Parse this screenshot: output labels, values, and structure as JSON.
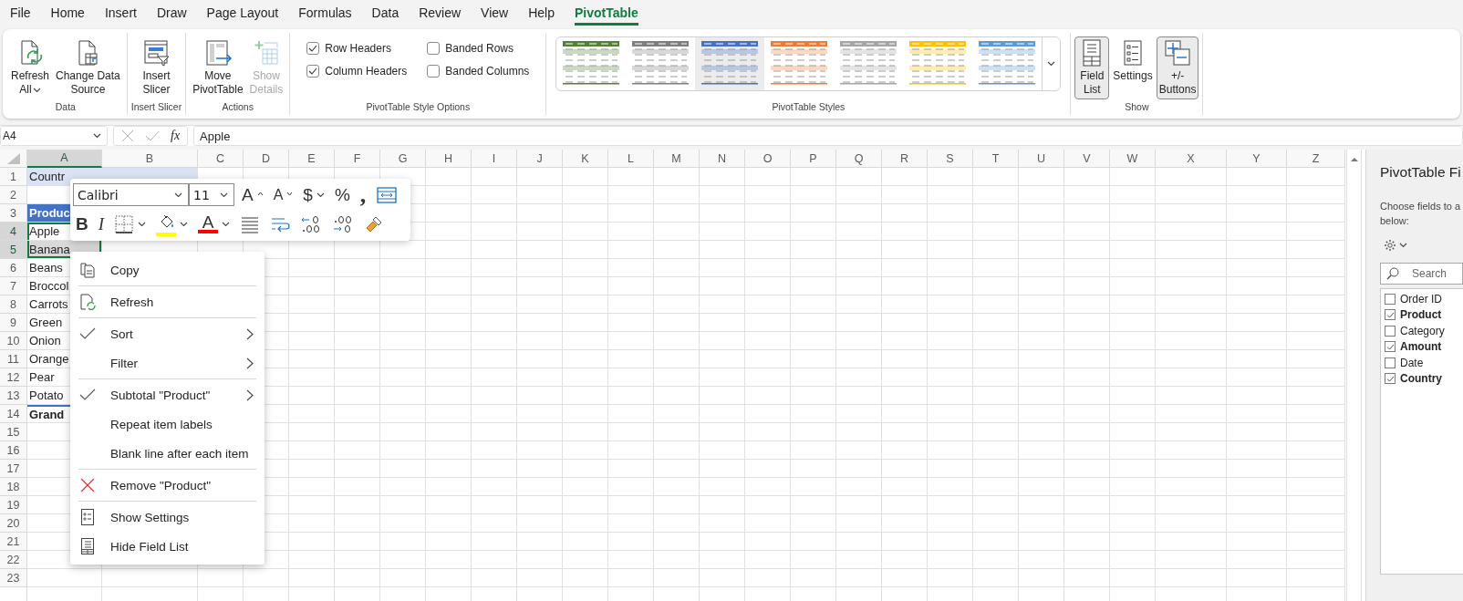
{
  "menu_tabs": [
    {
      "label": "File",
      "selected": false
    },
    {
      "label": "Home",
      "selected": false
    },
    {
      "label": "Insert",
      "selected": false
    },
    {
      "label": "Draw",
      "selected": false
    },
    {
      "label": "Page Layout",
      "selected": false
    },
    {
      "label": "Formulas",
      "selected": false
    },
    {
      "label": "Data",
      "selected": false
    },
    {
      "label": "Review",
      "selected": false
    },
    {
      "label": "View",
      "selected": false
    },
    {
      "label": "Help",
      "selected": false
    },
    {
      "label": "PivotTable",
      "selected": true
    }
  ],
  "ribbon": {
    "groups": [
      {
        "label": "Data",
        "items": [
          {
            "kind": "button",
            "lines": [
              "Refresh",
              "All"
            ],
            "caret": true,
            "disabled": false,
            "pressed": false
          },
          {
            "kind": "button",
            "lines": [
              "Change Data",
              "Source"
            ],
            "caret": false,
            "disabled": false,
            "pressed": false
          }
        ]
      },
      {
        "label": "Insert Slicer",
        "items": [
          {
            "kind": "button",
            "lines": [
              "Insert",
              "Slicer"
            ],
            "caret": false,
            "disabled": false,
            "pressed": false
          }
        ]
      },
      {
        "label": "Actions",
        "items": [
          {
            "kind": "button",
            "lines": [
              "Move",
              "PivotTable"
            ],
            "caret": false,
            "disabled": false,
            "pressed": false
          },
          {
            "kind": "button",
            "lines": [
              "Show",
              "Details"
            ],
            "caret": false,
            "disabled": true,
            "pressed": false
          }
        ]
      },
      {
        "label": "PivotTable Style Options",
        "items": [
          {
            "kind": "checkbox",
            "label": "Row Headers",
            "checked": true
          },
          {
            "kind": "checkbox",
            "label": "Column Headers",
            "checked": true
          },
          {
            "kind": "checkbox",
            "label": "Banded Rows",
            "checked": false
          },
          {
            "kind": "checkbox",
            "label": "Banded Columns",
            "checked": false
          }
        ]
      },
      {
        "label": "PivotTable Styles",
        "items": [
          {
            "kind": "gallery",
            "styles": [
              {
                "color": "#548235",
                "selected": false
              },
              {
                "color": "#7f7f7f",
                "selected": false
              },
              {
                "color": "#4472c4",
                "selected": true
              },
              {
                "color": "#ed7d31",
                "selected": false
              },
              {
                "color": "#a5a5a5",
                "selected": false
              },
              {
                "color": "#ffc000",
                "selected": false
              },
              {
                "color": "#5b9bd5",
                "selected": false
              }
            ]
          }
        ]
      },
      {
        "label": "Show",
        "items": [
          {
            "kind": "button",
            "lines": [
              "Field",
              "List"
            ],
            "caret": false,
            "disabled": false,
            "pressed": true
          },
          {
            "kind": "button",
            "lines": [
              "Settings"
            ],
            "caret": false,
            "disabled": false,
            "pressed": false
          },
          {
            "kind": "button",
            "lines": [
              "+/-",
              "Buttons"
            ],
            "caret": false,
            "disabled": false,
            "pressed": true
          }
        ]
      }
    ]
  },
  "formula_bar": {
    "name_box": "A4",
    "function_label": "fx",
    "formula": "Apple"
  },
  "sheet": {
    "columns": [
      {
        "label": "A",
        "selected": true
      },
      {
        "label": "B",
        "selected": false
      },
      {
        "label": "C",
        "selected": false
      },
      {
        "label": "D",
        "selected": false
      },
      {
        "label": "E",
        "selected": false
      },
      {
        "label": "F",
        "selected": false
      },
      {
        "label": "G",
        "selected": false
      },
      {
        "label": "H",
        "selected": false
      },
      {
        "label": "I",
        "selected": false
      },
      {
        "label": "J",
        "selected": false
      },
      {
        "label": "K",
        "selected": false
      },
      {
        "label": "L",
        "selected": false
      },
      {
        "label": "M",
        "selected": false
      },
      {
        "label": "N",
        "selected": false
      },
      {
        "label": "O",
        "selected": false
      },
      {
        "label": "P",
        "selected": false
      },
      {
        "label": "Q",
        "selected": false
      },
      {
        "label": "R",
        "selected": false
      },
      {
        "label": "S",
        "selected": false
      },
      {
        "label": "T",
        "selected": false
      },
      {
        "label": "U",
        "selected": false
      },
      {
        "label": "V",
        "selected": false
      },
      {
        "label": "W",
        "selected": false
      },
      {
        "label": "X",
        "selected": false
      },
      {
        "label": "Y",
        "selected": false
      },
      {
        "label": "Z",
        "selected": false
      }
    ],
    "rows": [
      {
        "label": "1",
        "selected": false,
        "cell_a": {
          "text": "Countr",
          "kind": "filter",
          "selected": false
        }
      },
      {
        "label": "2",
        "selected": false
      },
      {
        "label": "3",
        "selected": false,
        "cell_a": {
          "text": "Produc",
          "kind": "header",
          "selected": false
        }
      },
      {
        "label": "4",
        "selected": true,
        "cell_a": {
          "text": "Apple",
          "kind": "item",
          "selected": true
        }
      },
      {
        "label": "5",
        "selected": true,
        "cell_a": {
          "text": "Banana",
          "kind": "item",
          "selected": true
        }
      },
      {
        "label": "6",
        "selected": false,
        "cell_a": {
          "text": "Beans",
          "kind": "item",
          "selected": false
        }
      },
      {
        "label": "7",
        "selected": false,
        "cell_a": {
          "text": "Broccol",
          "kind": "item",
          "selected": false
        }
      },
      {
        "label": "8",
        "selected": false,
        "cell_a": {
          "text": "Carrots",
          "kind": "item",
          "selected": false
        }
      },
      {
        "label": "9",
        "selected": false,
        "cell_a": {
          "text": "Green",
          "kind": "item",
          "selected": false
        }
      },
      {
        "label": "10",
        "selected": false,
        "cell_a": {
          "text": "Onion",
          "kind": "item",
          "selected": false
        }
      },
      {
        "label": "11",
        "selected": false,
        "cell_a": {
          "text": "Orange",
          "kind": "item",
          "selected": false
        }
      },
      {
        "label": "12",
        "selected": false,
        "cell_a": {
          "text": "Pear",
          "kind": "item",
          "selected": false
        }
      },
      {
        "label": "13",
        "selected": false,
        "cell_a": {
          "text": "Potato",
          "kind": "item",
          "selected": false
        }
      },
      {
        "label": "14",
        "selected": false,
        "cell_a": {
          "text": "Grand",
          "kind": "total",
          "selected": false
        }
      },
      {
        "label": "15",
        "selected": false
      },
      {
        "label": "16",
        "selected": false
      },
      {
        "label": "17",
        "selected": false
      },
      {
        "label": "18",
        "selected": false
      },
      {
        "label": "19",
        "selected": false
      },
      {
        "label": "20",
        "selected": false
      },
      {
        "label": "21",
        "selected": false
      },
      {
        "label": "22",
        "selected": false
      },
      {
        "label": "23",
        "selected": false
      }
    ]
  },
  "mini_toolbar": {
    "font": "Calibri",
    "size": "11",
    "tools": [
      {
        "kind": "grow_font",
        "glyph": "A"
      },
      {
        "kind": "shrink_font",
        "glyph": "A"
      },
      {
        "kind": "currency",
        "glyph": "$"
      },
      {
        "kind": "percent",
        "glyph": "%"
      },
      {
        "kind": "comma",
        "glyph": ","
      },
      {
        "kind": "merge"
      }
    ],
    "tools_row2": [
      {
        "kind": "bold",
        "glyph": "B"
      },
      {
        "kind": "italic",
        "glyph": "I"
      },
      {
        "kind": "borders"
      },
      {
        "kind": "fill_color",
        "color": "#ffff00"
      },
      {
        "kind": "font_color",
        "glyph": "A",
        "color": "#ff0000"
      },
      {
        "kind": "align"
      },
      {
        "kind": "wrap_text"
      },
      {
        "kind": "increase_decimal"
      },
      {
        "kind": "decrease_decimal"
      },
      {
        "kind": "format_painter"
      }
    ]
  },
  "context_menu": {
    "sections": [
      [
        {
          "kind": "copy",
          "label": "Copy",
          "submenu": false
        }
      ],
      [
        {
          "kind": "refresh",
          "label": "Refresh",
          "submenu": false
        }
      ],
      [
        {
          "kind": "toggle",
          "label": "Sort",
          "checked": true,
          "submenu": true
        },
        {
          "kind": "toggle",
          "label": "Filter",
          "checked": false,
          "submenu": true
        }
      ],
      [
        {
          "kind": "toggle",
          "label": "Subtotal \"Product\"",
          "checked": true,
          "submenu": true
        },
        {
          "kind": "toggle",
          "label": "Repeat item labels",
          "checked": false,
          "submenu": false
        },
        {
          "kind": "toggle",
          "label": "Blank line after each item",
          "checked": false,
          "submenu": false
        }
      ],
      [
        {
          "kind": "remove",
          "label": "Remove \"Product\"",
          "submenu": false
        }
      ],
      [
        {
          "kind": "settings",
          "label": "Show Settings",
          "submenu": false
        },
        {
          "kind": "field_list",
          "label": "Hide Field List",
          "submenu": false
        }
      ]
    ]
  },
  "field_pane": {
    "title": "PivotTable Fi",
    "description": [
      "Choose fields to a",
      "below:"
    ],
    "search": {
      "placeholder": "Search"
    },
    "fields": [
      {
        "label": "Order ID",
        "checked": false
      },
      {
        "label": "Product",
        "checked": true
      },
      {
        "label": "Category",
        "checked": false
      },
      {
        "label": "Amount",
        "checked": true
      },
      {
        "label": "Date",
        "checked": false
      },
      {
        "label": "Country",
        "checked": true
      }
    ]
  }
}
